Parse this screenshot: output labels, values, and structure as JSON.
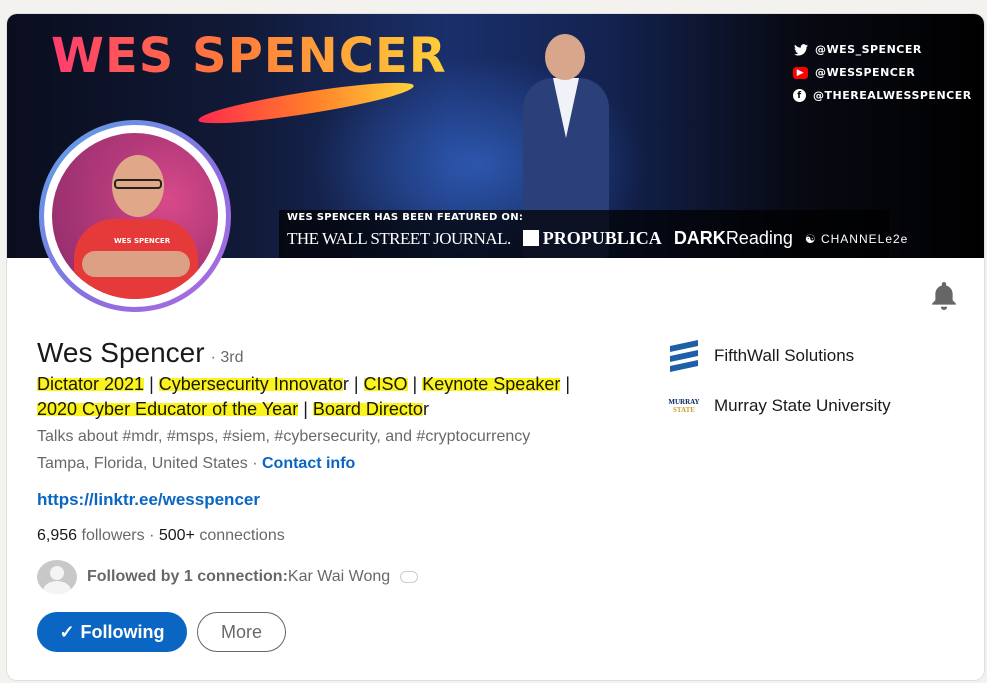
{
  "banner": {
    "name": "WES SPENCER",
    "socials": [
      {
        "icon": "twitter-icon",
        "handle": "@WES_SPENCER"
      },
      {
        "icon": "youtube-icon",
        "handle": "@WESSPENCER"
      },
      {
        "icon": "facebook-icon",
        "handle": "@THEREALWESSPENCER"
      }
    ],
    "featured_label": "WES SPENCER HAS BEEN FEATURED ON:",
    "publications": [
      "THE WALL STREET JOURNAL.",
      "PROPUBLICA",
      "DARK",
      "Reading",
      "CHANNELe2e"
    ]
  },
  "profile": {
    "name": "Wes Spencer",
    "degree": "· 3rd",
    "headline": {
      "hl1": "Dictator 2021",
      "sep1": " | ",
      "hl2": "Cybersecurity Innovato",
      "tail2": "r",
      "sep2": " | ",
      "hl3": "CISO",
      "sep3": " | ",
      "hl4": "Keynote Speaker",
      "sep4": " |",
      "hl5": "2020 Cyber Educator of the Year",
      "sep5": " | ",
      "hl6": "Board Directo",
      "tail6": "r"
    },
    "talks": "Talks about #mdr, #msps, #siem, #cybersecurity, and #cryptocurrency",
    "location": "Tampa, Florida, United States",
    "location_sep": " · ",
    "contact_info": "Contact info",
    "website": "https://linktr.ee/wesspencer",
    "followers": "6,956",
    "followers_label": " followers",
    "connections": "500+",
    "connections_label": " connections",
    "connections_sep": " · ",
    "followed_by_prefix": "Followed by 1 connection:",
    "followed_by_name": " Kar Wai Wong"
  },
  "actions": {
    "following_icon": "✓",
    "following_label": "Following",
    "more_label": "More"
  },
  "organizations": [
    {
      "logo": "fifthwall-logo",
      "name": "FifthWall Solutions"
    },
    {
      "logo": "murray-state-logo",
      "logo_text_1": "MURRAY",
      "logo_text_2": "STATE",
      "name": "Murray State University"
    }
  ],
  "colors": {
    "primary": "#0a66c2",
    "highlight": "#fbf31f"
  }
}
